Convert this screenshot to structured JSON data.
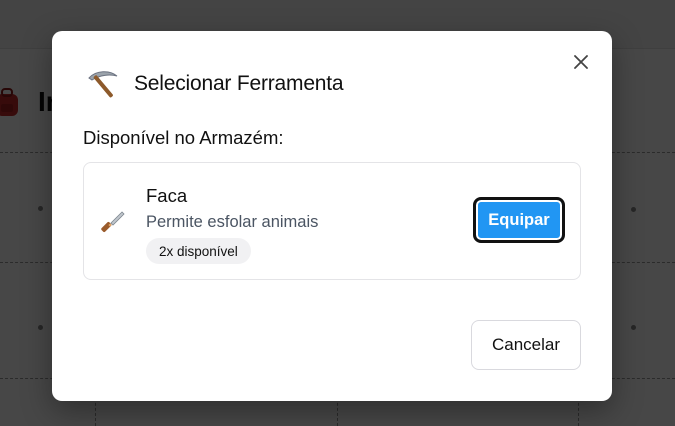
{
  "background": {
    "title": "In"
  },
  "modal": {
    "title": "Selecionar Ferramenta",
    "title_icon": "pickaxe-icon",
    "close_icon": "close-icon",
    "section_title": "Disponível no Armazém:",
    "tools": [
      {
        "icon": "knife-icon",
        "name": "Faca",
        "description": "Permite esfolar animais",
        "availability": "2x disponível",
        "action_label": "Equipar"
      }
    ],
    "cancel_label": "Cancelar"
  },
  "colors": {
    "accent": "#2196f3",
    "overlay": "rgba(0,0,0,0.72)"
  }
}
